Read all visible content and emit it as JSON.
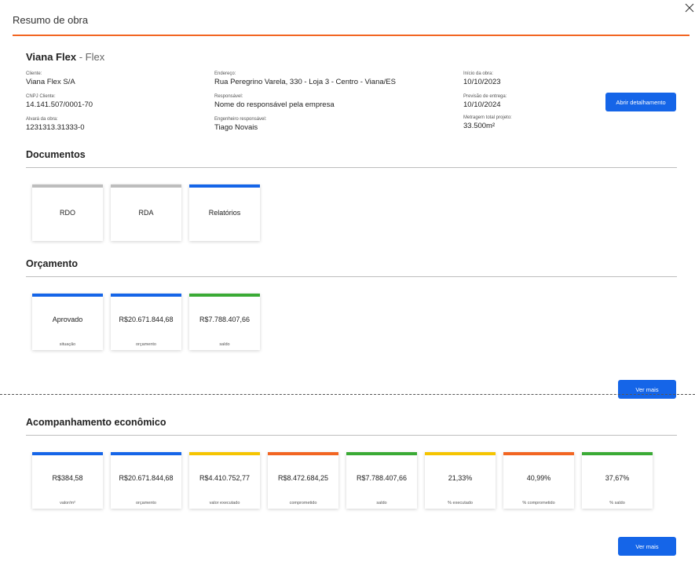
{
  "modal": {
    "title": "Resumo de obra"
  },
  "project": {
    "name": "Viana Flex",
    "separator": " - ",
    "type": "Flex"
  },
  "info": {
    "cliente": {
      "label": "Cliente:",
      "value": "Viana Flex S/A"
    },
    "cnpj": {
      "label": "CNPJ Cliente:",
      "value": "14.141.507/0001-70"
    },
    "alvara": {
      "label": "Alvará da obra:",
      "value": "1231313.31333-0"
    },
    "endereco": {
      "label": "Endereço:",
      "value": "Rua Peregrino Varela, 330 - Loja 3 - Centro - Viana/ES"
    },
    "responsavel": {
      "label": "Responsável:",
      "value": "Nome do responsável pela empresa"
    },
    "engenheiro": {
      "label": "Engenheiro responsável:",
      "value": "Tiago Novais"
    },
    "inicio": {
      "label": "Início da obra:",
      "value": "10/10/2023"
    },
    "previsao": {
      "label": "Previsão de entrega:",
      "value": "10/10/2024"
    },
    "metragem": {
      "label": "Metragem total projeto:",
      "value": "33.500m²"
    }
  },
  "buttons": {
    "detalhamento": "Abrir detalhamento",
    "ver_mais": "Ver mais"
  },
  "sections": {
    "documentos": {
      "title": "Documentos",
      "cards": [
        {
          "value": "RDO",
          "color": "#bdbdbd"
        },
        {
          "value": "RDA",
          "color": "#bdbdbd"
        },
        {
          "value": "Relatórios",
          "color": "#1565e8"
        }
      ]
    },
    "orcamento": {
      "title": "Orçamento",
      "cards": [
        {
          "value": "Aprovado",
          "label": "situação",
          "color": "#1565e8"
        },
        {
          "value": "R$20.671.844,68",
          "label": "orçamento",
          "color": "#1565e8"
        },
        {
          "value": "R$7.788.407,66",
          "label": "saldo",
          "color": "#3aaa35"
        }
      ]
    },
    "acompanhamento": {
      "title": "Acompanhamento econômico",
      "cards": [
        {
          "value": "R$384,58",
          "label": "valor/m²",
          "color": "#1565e8"
        },
        {
          "value": "R$20.671.844,68",
          "label": "orçamento",
          "color": "#1565e8"
        },
        {
          "value": "R$4.410.752,77",
          "label": "valor executado",
          "color": "#f5c400"
        },
        {
          "value": "R$8.472.684,25",
          "label": "comprometido",
          "color": "#f26522"
        },
        {
          "value": "R$7.788.407,66",
          "label": "saldo",
          "color": "#3aaa35"
        },
        {
          "value": "21,33%",
          "label": "% executado",
          "color": "#f5c400"
        },
        {
          "value": "40,99%",
          "label": "% comprometido",
          "color": "#f26522"
        },
        {
          "value": "37,67%",
          "label": "% saldo",
          "color": "#3aaa35"
        }
      ]
    }
  }
}
